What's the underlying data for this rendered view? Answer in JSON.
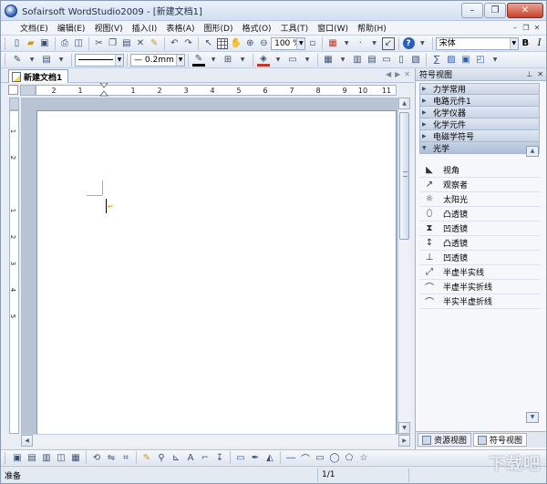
{
  "window": {
    "title": "Sofairsoft WordStudio2009 - [新建文档1]",
    "controls": {
      "minimize": "–",
      "restore": "❐",
      "close": "✕"
    }
  },
  "menubar": {
    "items": [
      "文档(E)",
      "编辑(E)",
      "视图(V)",
      "插入(I)",
      "表格(A)",
      "图形(D)",
      "格式(O)",
      "工具(T)",
      "窗口(W)",
      "帮助(H)"
    ]
  },
  "toolbar1": {
    "zoom": "100 %",
    "font": "宋体",
    "bold": "B",
    "italic": "I"
  },
  "toolbar2": {
    "line_width": "0.2mm"
  },
  "document": {
    "tab_label": "新建文档1",
    "ruler_labels": [
      "2",
      "1",
      "1",
      "2",
      "3",
      "4",
      "5",
      "6",
      "7",
      "8",
      "9",
      "10",
      "11"
    ],
    "vruler_labels": [
      "1",
      "2",
      "1",
      "2",
      "3",
      "4",
      "5"
    ]
  },
  "panel": {
    "title": "符号视图",
    "categories": [
      {
        "label": "力学常用",
        "open": false
      },
      {
        "label": "电路元件1",
        "open": false
      },
      {
        "label": "化学仪器",
        "open": false
      },
      {
        "label": "化学元件",
        "open": false
      },
      {
        "label": "电磁学符号",
        "open": false
      },
      {
        "label": "光学",
        "open": true
      }
    ],
    "symbols": [
      {
        "label": "视角",
        "icon": "eye-icon"
      },
      {
        "label": "观察者",
        "icon": "observer-icon"
      },
      {
        "label": "太阳光",
        "icon": "sun-icon"
      },
      {
        "label": "凸透镜",
        "icon": "convex-lens-icon"
      },
      {
        "label": "凹透镜",
        "icon": "concave-lens-icon"
      },
      {
        "label": "凸透镜",
        "icon": "convex-lens-symbol-icon"
      },
      {
        "label": "凹透镜",
        "icon": "concave-lens-symbol-icon"
      },
      {
        "label": "半虚半实线",
        "icon": "half-dashed-line-icon"
      },
      {
        "label": "半虚半实折线",
        "icon": "half-dashed-polyline-icon"
      },
      {
        "label": "半实半虚折线",
        "icon": "half-solid-polyline-icon"
      }
    ],
    "tabs": [
      "资源视图",
      "符号视图"
    ]
  },
  "statusbar": {
    "status": "准备",
    "page": "1/1"
  },
  "watermark": "下载吧",
  "colors": {
    "accent": "#2a5fb8",
    "panel_header": "#cdd8e7",
    "canvas_bg": "#b8c4d4"
  }
}
